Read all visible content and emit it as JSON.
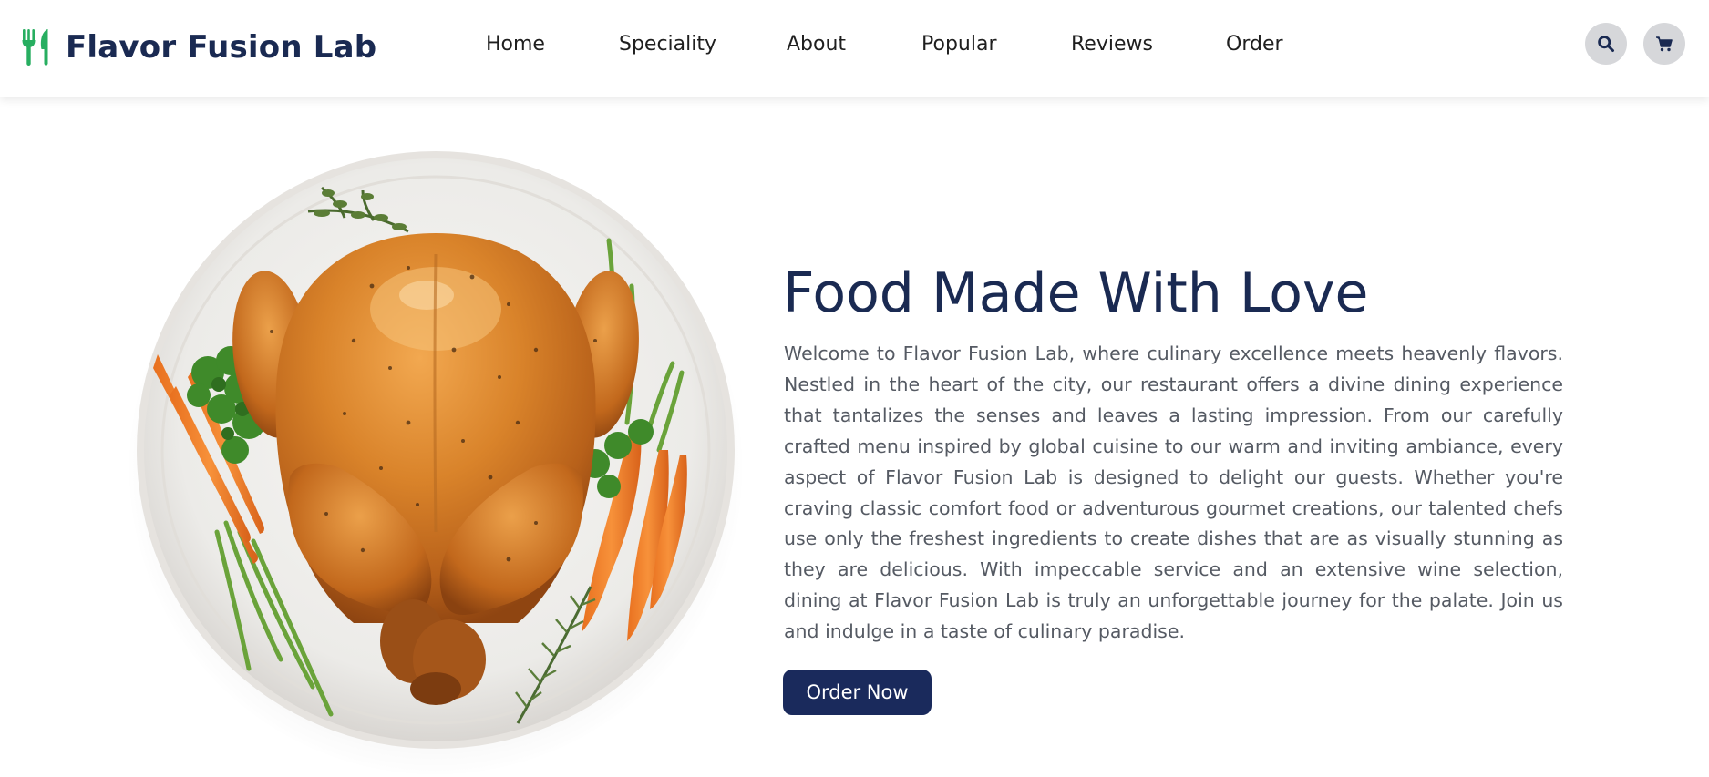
{
  "brand": {
    "name": "Flavor Fusion Lab",
    "accent_color": "#27ae60",
    "primary_color": "#1a2a52"
  },
  "nav": {
    "items": [
      {
        "label": "Home"
      },
      {
        "label": "Speciality"
      },
      {
        "label": "About"
      },
      {
        "label": "Popular"
      },
      {
        "label": "Reviews"
      },
      {
        "label": "Order"
      }
    ]
  },
  "header_icons": {
    "search": "search-icon",
    "cart": "cart-icon"
  },
  "hero": {
    "title": "Food Made With Love",
    "description": "Welcome to Flavor Fusion Lab, where culinary excellence meets heavenly flavors. Nestled in the heart of the city, our restaurant offers a divine dining experience that tantalizes the senses and leaves a lasting impression. From our carefully crafted menu inspired by global cuisine to our warm and inviting ambiance, every aspect of Flavor Fusion Lab is designed to delight our guests. Whether you're craving classic comfort food or adventurous gourmet creations, our talented chefs use only the freshest ingredients to create dishes that are as visually stunning as they are delicious. With impeccable service and an extensive wine selection, dining at Flavor Fusion Lab is truly an unforgettable journey for the palate. Join us and indulge in a taste of culinary paradise.",
    "cta_label": "Order Now",
    "image": "roast-chicken-plate-image"
  }
}
